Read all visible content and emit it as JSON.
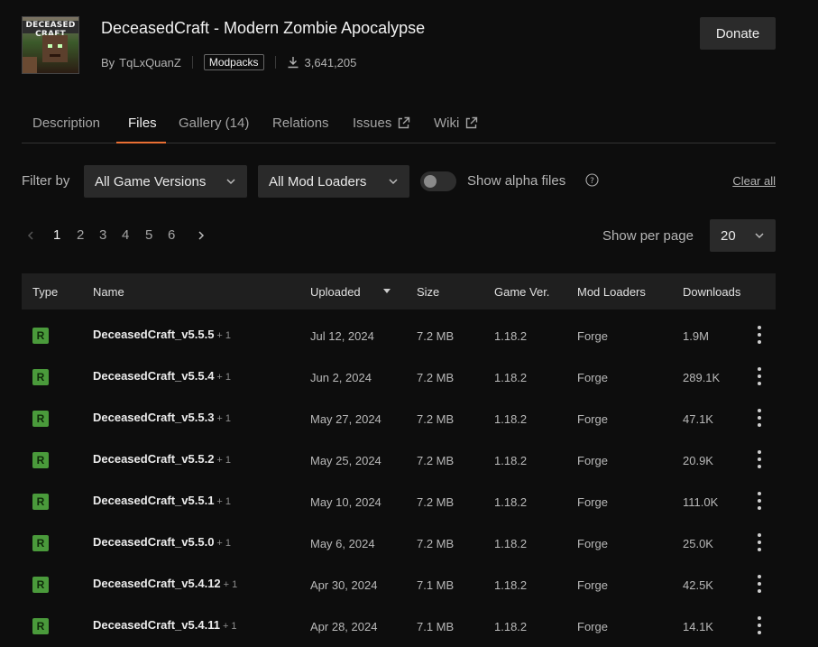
{
  "project": {
    "logo_text": "DECEASED CRAFT",
    "title": "DeceasedCraft - Modern Zombie Apocalypse",
    "by_label": "By",
    "author": "TqLxQuanZ",
    "category": "Modpacks",
    "downloads": "3,641,205",
    "donate_label": "Donate"
  },
  "tabs": [
    {
      "label": "Description",
      "active": false
    },
    {
      "label": "Files",
      "active": true
    },
    {
      "label": "Gallery (14)",
      "active": false
    },
    {
      "label": "Relations",
      "active": false
    },
    {
      "label": "Issues",
      "active": false,
      "external": true
    },
    {
      "label": "Wiki",
      "active": false,
      "external": true
    }
  ],
  "filters": {
    "label": "Filter by",
    "game_versions": "All Game Versions",
    "mod_loaders": "All Mod Loaders",
    "alpha_label": "Show alpha files",
    "alpha_enabled": false,
    "clear_all": "Clear all"
  },
  "pagination": {
    "pages": [
      "1",
      "2",
      "3",
      "4",
      "5",
      "6"
    ],
    "current": "1",
    "per_page_label": "Show per page",
    "per_page_value": "20"
  },
  "table": {
    "headers": {
      "type": "Type",
      "name": "Name",
      "uploaded": "Uploaded",
      "size": "Size",
      "game_ver": "Game Ver.",
      "mod_loaders": "Mod Loaders",
      "downloads": "Downloads"
    },
    "rows": [
      {
        "type": "R",
        "name": "DeceasedCraft_v5.5.5",
        "extra": "+ 1",
        "uploaded": "Jul 12, 2024",
        "size": "7.2 MB",
        "game_ver": "1.18.2",
        "loader": "Forge",
        "downloads": "1.9M"
      },
      {
        "type": "R",
        "name": "DeceasedCraft_v5.5.4",
        "extra": "+ 1",
        "uploaded": "Jun 2, 2024",
        "size": "7.2 MB",
        "game_ver": "1.18.2",
        "loader": "Forge",
        "downloads": "289.1K"
      },
      {
        "type": "R",
        "name": "DeceasedCraft_v5.5.3",
        "extra": "+ 1",
        "uploaded": "May 27, 2024",
        "size": "7.2 MB",
        "game_ver": "1.18.2",
        "loader": "Forge",
        "downloads": "47.1K"
      },
      {
        "type": "R",
        "name": "DeceasedCraft_v5.5.2",
        "extra": "+ 1",
        "uploaded": "May 25, 2024",
        "size": "7.2 MB",
        "game_ver": "1.18.2",
        "loader": "Forge",
        "downloads": "20.9K"
      },
      {
        "type": "R",
        "name": "DeceasedCraft_v5.5.1",
        "extra": "+ 1",
        "uploaded": "May 10, 2024",
        "size": "7.2 MB",
        "game_ver": "1.18.2",
        "loader": "Forge",
        "downloads": "111.0K"
      },
      {
        "type": "R",
        "name": "DeceasedCraft_v5.5.0",
        "extra": "+ 1",
        "uploaded": "May 6, 2024",
        "size": "7.2 MB",
        "game_ver": "1.18.2",
        "loader": "Forge",
        "downloads": "25.0K"
      },
      {
        "type": "R",
        "name": "DeceasedCraft_v5.4.12",
        "extra": "+ 1",
        "uploaded": "Apr 30, 2024",
        "size": "7.1 MB",
        "game_ver": "1.18.2",
        "loader": "Forge",
        "downloads": "42.5K"
      },
      {
        "type": "R",
        "name": "DeceasedCraft_v5.4.11",
        "extra": "+ 1",
        "uploaded": "Apr 28, 2024",
        "size": "7.1 MB",
        "game_ver": "1.18.2",
        "loader": "Forge",
        "downloads": "14.1K"
      }
    ]
  },
  "colors": {
    "accent": "#e96f33",
    "release_badge": "#4a9a3b",
    "background": "#0d0d0d"
  }
}
